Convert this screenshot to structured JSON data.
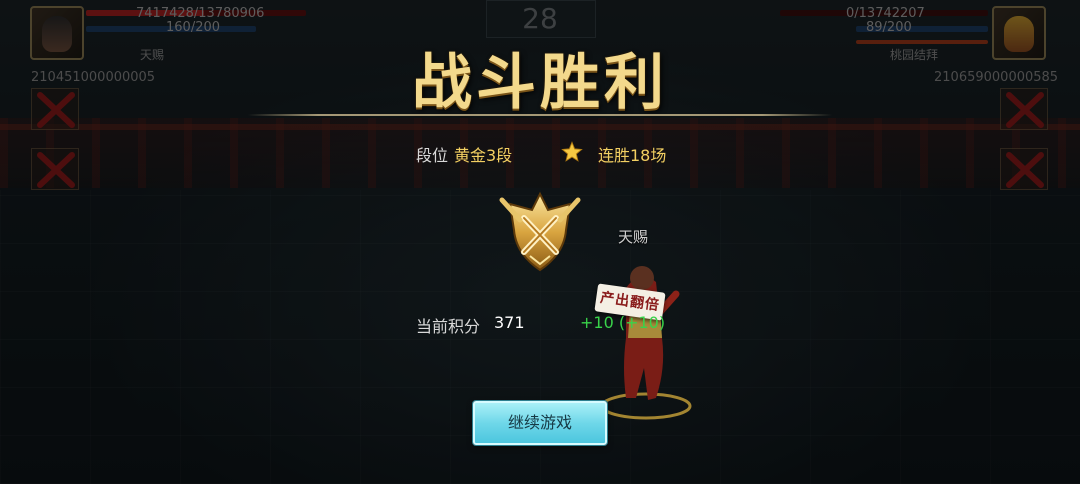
{
  "hud": {
    "left": {
      "hp": "7417428/13780906",
      "energy": "160/200",
      "name": "天赐",
      "id": "210451000000005"
    },
    "right": {
      "hp": "0/13742207",
      "energy": "89/200",
      "name": "桃园结拜",
      "id": "210659000000585"
    },
    "timer": "28"
  },
  "result": {
    "title": "战斗胜利",
    "rank_label": "段位",
    "rank_value": "黄金3段",
    "streak": "连胜18场",
    "score_label": "当前积分",
    "score_value": "371",
    "score_delta": "+10 (+10)",
    "continue_label": "继续游戏"
  },
  "scene": {
    "hero_name": "天赐",
    "badge_text": "产出翻倍"
  },
  "colors": {
    "title_gold": "#f3d98c",
    "value_gold": "#f2cf62",
    "delta_green": "#39d24a",
    "button_cyan": "#6fd7e9"
  },
  "icons": [
    "star-icon",
    "rank-emblem-icon",
    "disabled-slot-icon"
  ]
}
